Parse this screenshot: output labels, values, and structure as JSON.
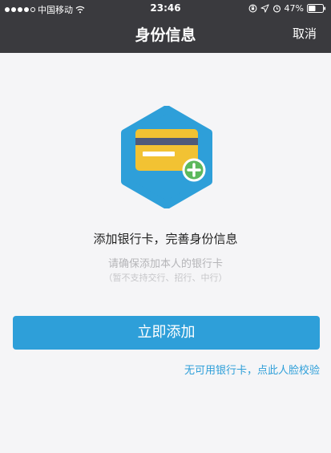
{
  "status_bar": {
    "carrier": "中国移动",
    "time": "23:46",
    "battery": "47%"
  },
  "header": {
    "title": "身份信息",
    "cancel_label": "取消"
  },
  "hero": {
    "icon": "add-bank-card-icon",
    "hex_color": "#2e9fd9",
    "card_color": "#f2c233",
    "plus_color": "#5cb85c"
  },
  "main": {
    "message": "添加银行卡，完善身份信息",
    "sub_message": "请确保添加本人的银行卡",
    "note": "（暂不支持交行、招行、中行）"
  },
  "actions": {
    "add_button_label": "立即添加",
    "face_verify_link": "无可用银行卡，点此人脸校验"
  },
  "colors": {
    "header_bg": "#3a3a3e",
    "accent": "#2e9fd9",
    "page_bg": "#f5f5f7"
  }
}
